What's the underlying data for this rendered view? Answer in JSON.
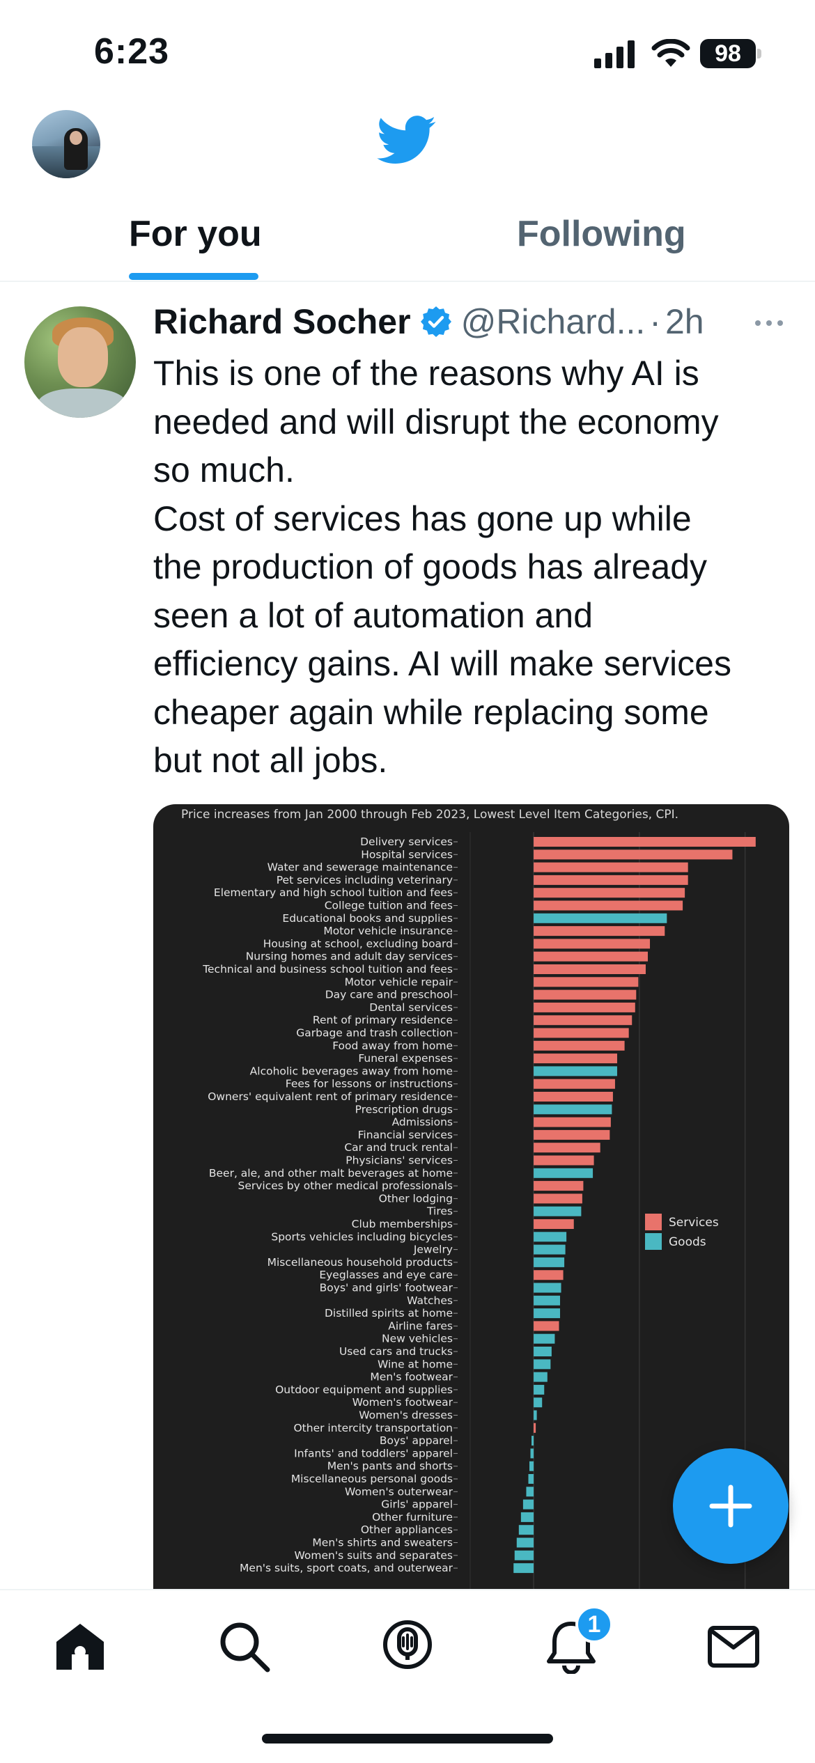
{
  "status_bar": {
    "time": "6:23",
    "battery": "98"
  },
  "tabs": [
    {
      "label": "For you",
      "active": true
    },
    {
      "label": "Following",
      "active": false
    }
  ],
  "tweet": {
    "author_name": "Richard Socher",
    "handle": "@Richard...",
    "separator": "·",
    "time": "2h",
    "text": "This is one of the reasons why AI is\nneeded and will disrupt the economy\nso much.\nCost of services has gone up while\nthe production of goods has already\nseen a lot of automation and\nefficiency gains. AI will make services\ncheaper again while replacing some\nbut not all jobs."
  },
  "chart_data": {
    "type": "bar",
    "orientation": "horizontal",
    "title": "Price increases from Jan 2000 through Feb 2023, Lowest Level Item Categories, CPI.",
    "legend": {
      "placement": "right",
      "entries": [
        {
          "name": "Services",
          "color": "#e8736b"
        },
        {
          "name": "Goods",
          "color": "#4ab8c2"
        }
      ]
    },
    "grid": true,
    "categories": [
      {
        "label": "Delivery services",
        "value": 210,
        "group": "Services"
      },
      {
        "label": "Hospital services",
        "value": 188,
        "group": "Services"
      },
      {
        "label": "Water and sewerage maintenance",
        "value": 146,
        "group": "Services"
      },
      {
        "label": "Pet services including veterinary",
        "value": 146,
        "group": "Services"
      },
      {
        "label": "Elementary and high school tuition and fees",
        "value": 143,
        "group": "Services"
      },
      {
        "label": "College tuition and fees",
        "value": 141,
        "group": "Services"
      },
      {
        "label": "Educational books and supplies",
        "value": 126,
        "group": "Goods"
      },
      {
        "label": "Motor vehicle insurance",
        "value": 124,
        "group": "Services"
      },
      {
        "label": "Housing at school, excluding board",
        "value": 110,
        "group": "Services"
      },
      {
        "label": "Nursing homes and adult day services",
        "value": 108,
        "group": "Services"
      },
      {
        "label": "Technical and business school tuition and fees",
        "value": 106,
        "group": "Services"
      },
      {
        "label": "Motor vehicle repair",
        "value": 99,
        "group": "Services"
      },
      {
        "label": "Day care and preschool",
        "value": 97,
        "group": "Services"
      },
      {
        "label": "Dental services",
        "value": 96,
        "group": "Services"
      },
      {
        "label": "Rent of primary residence",
        "value": 93,
        "group": "Services"
      },
      {
        "label": "Garbage and trash collection",
        "value": 90,
        "group": "Services"
      },
      {
        "label": "Food away from home",
        "value": 86,
        "group": "Services"
      },
      {
        "label": "Funeral expenses",
        "value": 79,
        "group": "Services"
      },
      {
        "label": "Alcoholic beverages away from home",
        "value": 79,
        "group": "Goods"
      },
      {
        "label": "Fees for lessons or instructions",
        "value": 77,
        "group": "Services"
      },
      {
        "label": "Owners' equivalent rent of primary residence",
        "value": 75,
        "group": "Services"
      },
      {
        "label": "Prescription drugs",
        "value": 74,
        "group": "Goods"
      },
      {
        "label": "Admissions",
        "value": 73,
        "group": "Services"
      },
      {
        "label": "Financial services",
        "value": 72,
        "group": "Services"
      },
      {
        "label": "Car and truck rental",
        "value": 63,
        "group": "Services"
      },
      {
        "label": "Physicians' services",
        "value": 57,
        "group": "Services"
      },
      {
        "label": "Beer, ale, and other malt beverages at home",
        "value": 56,
        "group": "Goods"
      },
      {
        "label": "Services by other medical professionals",
        "value": 47,
        "group": "Services"
      },
      {
        "label": "Other lodging",
        "value": 46,
        "group": "Services"
      },
      {
        "label": "Tires",
        "value": 45,
        "group": "Goods"
      },
      {
        "label": "Club memberships",
        "value": 38,
        "group": "Services"
      },
      {
        "label": "Sports vehicles including bicycles",
        "value": 31,
        "group": "Goods"
      },
      {
        "label": "Jewelry",
        "value": 30,
        "group": "Goods"
      },
      {
        "label": "Miscellaneous household products",
        "value": 29,
        "group": "Goods"
      },
      {
        "label": "Eyeglasses and eye care",
        "value": 28,
        "group": "Services"
      },
      {
        "label": "Boys' and girls' footwear",
        "value": 26,
        "group": "Goods"
      },
      {
        "label": "Watches",
        "value": 25,
        "group": "Goods"
      },
      {
        "label": "Distilled spirits at home",
        "value": 25,
        "group": "Goods"
      },
      {
        "label": "Airline fares",
        "value": 24,
        "group": "Services"
      },
      {
        "label": "New vehicles",
        "value": 20,
        "group": "Goods"
      },
      {
        "label": "Used cars and trucks",
        "value": 17,
        "group": "Goods"
      },
      {
        "label": "Wine at home",
        "value": 16,
        "group": "Goods"
      },
      {
        "label": "Men's footwear",
        "value": 13,
        "group": "Goods"
      },
      {
        "label": "Outdoor equipment and supplies",
        "value": 10,
        "group": "Goods"
      },
      {
        "label": "Women's footwear",
        "value": 8,
        "group": "Goods"
      },
      {
        "label": "Women's dresses",
        "value": 3,
        "group": "Goods"
      },
      {
        "label": "Other intercity transportation",
        "value": 2,
        "group": "Services"
      },
      {
        "label": "Boys' apparel",
        "value": -2,
        "group": "Goods"
      },
      {
        "label": "Infants' and toddlers' apparel",
        "value": -3,
        "group": "Goods"
      },
      {
        "label": "Men's pants and shorts",
        "value": -4,
        "group": "Goods"
      },
      {
        "label": "Miscellaneous personal goods",
        "value": -5,
        "group": "Goods"
      },
      {
        "label": "Women's outerwear",
        "value": -7,
        "group": "Goods"
      },
      {
        "label": "Girls' apparel",
        "value": -10,
        "group": "Goods"
      },
      {
        "label": "Other furniture",
        "value": -12,
        "group": "Goods"
      },
      {
        "label": "Other appliances",
        "value": -14,
        "group": "Goods"
      },
      {
        "label": "Men's shirts and sweaters",
        "value": -16,
        "group": "Goods"
      },
      {
        "label": "Women's suits and separates",
        "value": -18,
        "group": "Goods"
      },
      {
        "label": "Men's suits, sport coats, and outerwear",
        "value": -19,
        "group": "Goods"
      }
    ],
    "xlim": [
      -60,
      220
    ]
  },
  "bottom_nav": {
    "notification_count": "1"
  },
  "colors": {
    "accent": "#1d9bf0",
    "services": "#e8736b",
    "goods": "#4ab8c2",
    "chart_bg": "#1e1e1e"
  }
}
